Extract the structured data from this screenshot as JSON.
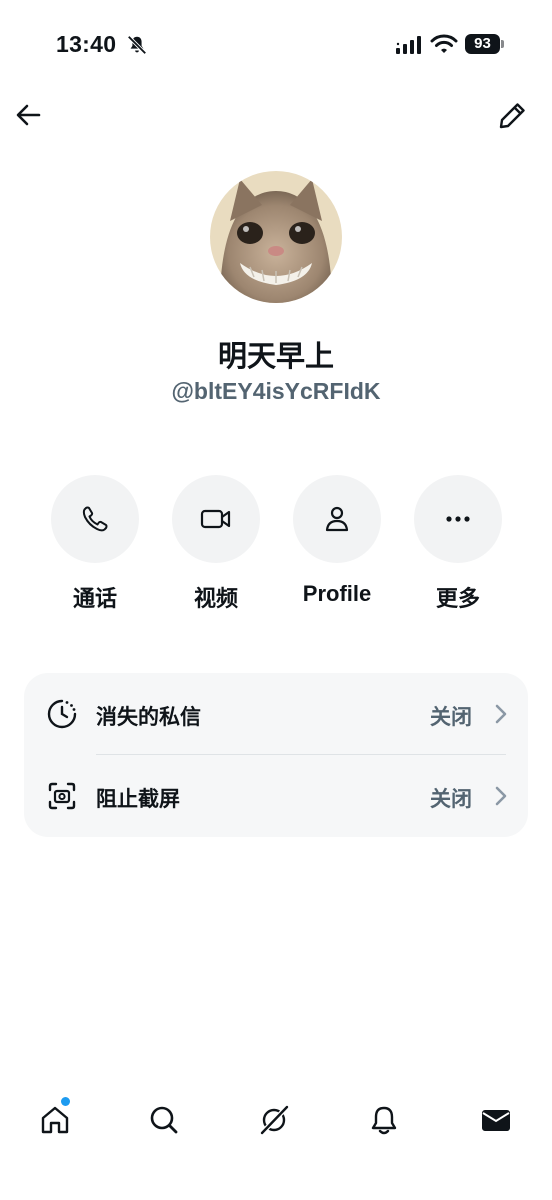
{
  "status_bar": {
    "time": "13:40",
    "battery": "93",
    "icons": [
      "bell-off-icon",
      "signal-icon",
      "wifi-icon",
      "battery-icon"
    ]
  },
  "header": {
    "back_icon": "arrow-left-icon",
    "edit_icon": "pencil-icon"
  },
  "profile": {
    "display_name": "明天早上",
    "handle": "@bltEY4isYcRFIdK"
  },
  "actions": [
    {
      "label": "通话",
      "icon": "phone-icon"
    },
    {
      "label": "视频",
      "icon": "video-camera-icon"
    },
    {
      "label": "Profile",
      "icon": "person-icon"
    },
    {
      "label": "更多",
      "icon": "more-dots-icon"
    }
  ],
  "settings": [
    {
      "title": "消失的私信",
      "value": "关闭",
      "icon": "timer-icon"
    },
    {
      "title": "阻止截屏",
      "value": "关闭",
      "icon": "screenshot-block-icon"
    }
  ],
  "bottom_nav": {
    "items": [
      "home-icon",
      "search-icon",
      "grok-icon",
      "notifications-icon",
      "messages-icon"
    ],
    "accent": "#1d9bf0"
  }
}
